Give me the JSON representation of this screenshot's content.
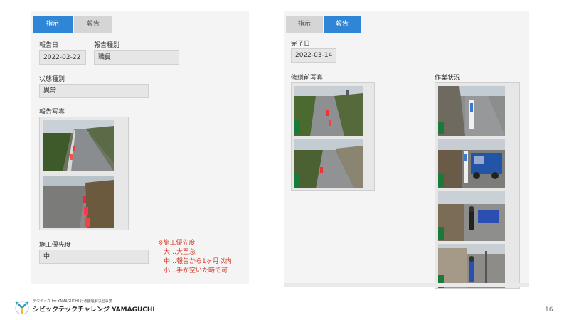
{
  "left": {
    "tabs": [
      {
        "label": "指示",
        "active": true
      },
      {
        "label": "報告",
        "active": false
      }
    ],
    "report_date_label": "報告日",
    "report_date_value": "2022-02-22",
    "report_type_label": "報告種別",
    "report_type_value": "職員",
    "status_type_label": "状態種別",
    "status_type_value": "異常",
    "report_photo_label": "報告写真",
    "priority_label": "施工優先度",
    "priority_value": "中"
  },
  "note": {
    "title": "※施工優先度",
    "lines": [
      "大…大至急",
      "中…報告から1ヶ月以内",
      "小…手が空いた時で可"
    ]
  },
  "right": {
    "tabs": [
      {
        "label": "指示",
        "active": false
      },
      {
        "label": "報告",
        "active": true
      }
    ],
    "completion_date_label": "完了日",
    "completion_date_value": "2022-03-14",
    "before_photo_label": "修繕前写真",
    "work_status_label": "作業状況"
  },
  "footer": {
    "subtitle": "デジテック for YAMAGUCHI 行政課題解決型事業",
    "brand": "シビックテックチャレンジ YAMAGUCHI",
    "page_number": "16"
  },
  "colors": {
    "active_tab": "#2f86d6",
    "note_red": "#d23b2b",
    "logo_teal": "#2a9fbf",
    "logo_yellow": "#f2b632"
  }
}
